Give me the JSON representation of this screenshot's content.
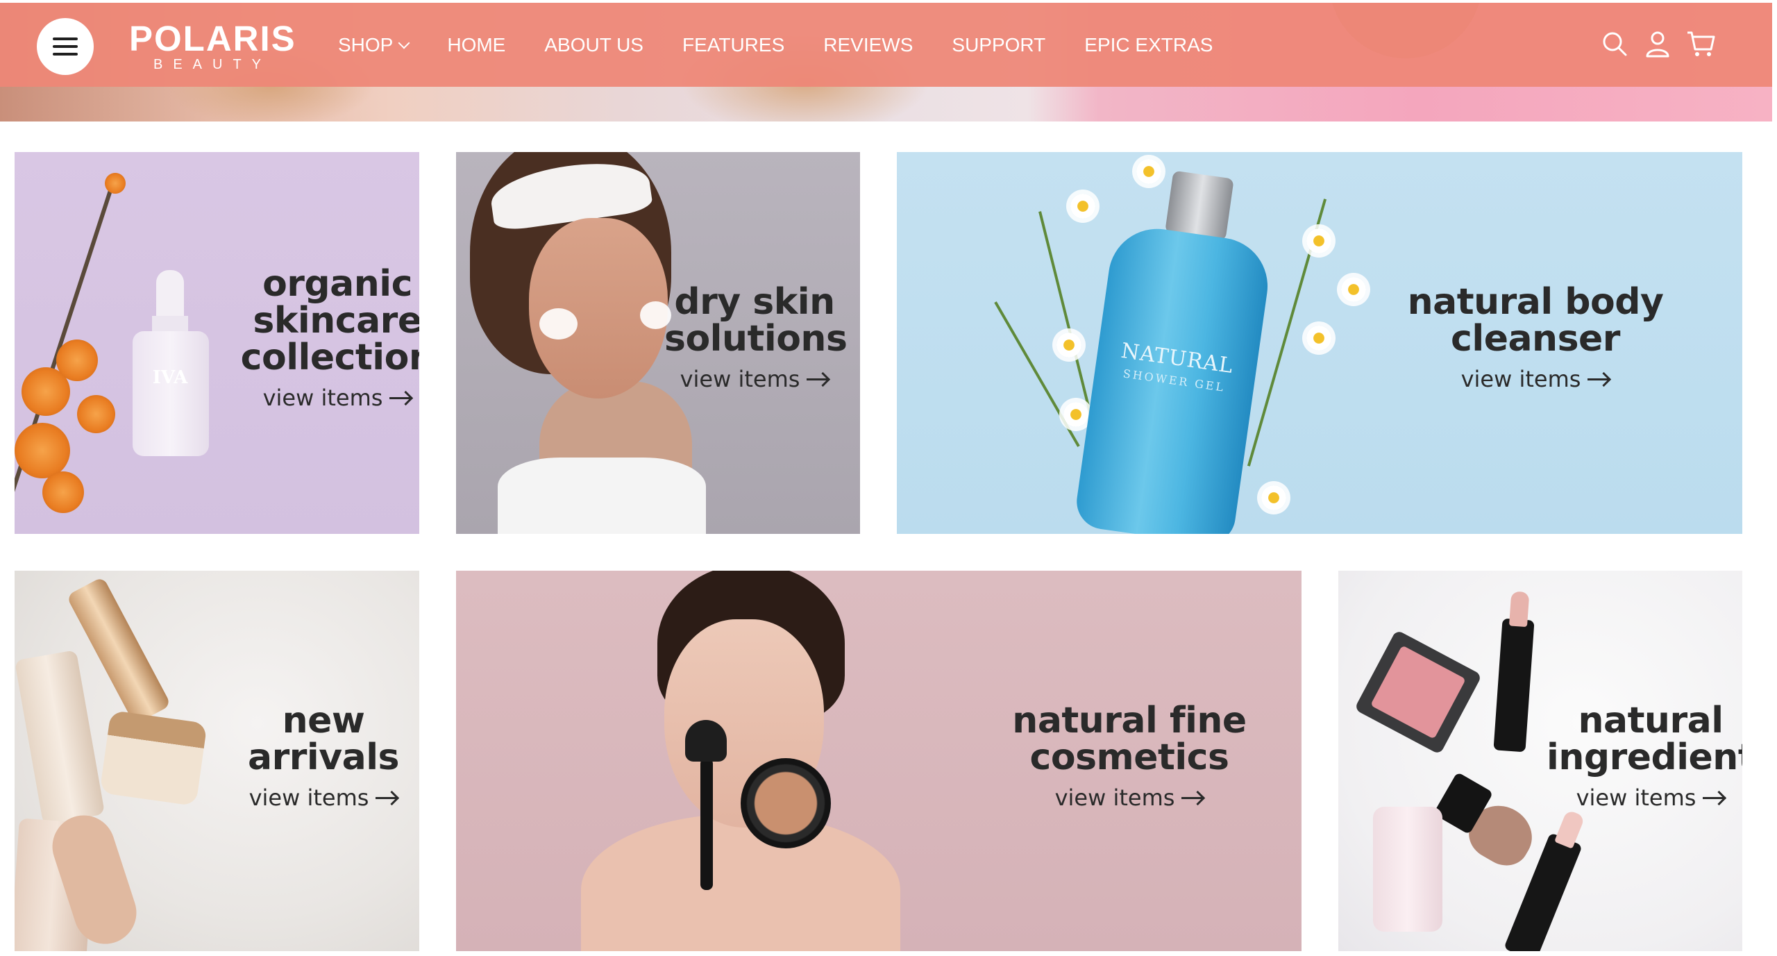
{
  "header": {
    "brand": "POLARIS",
    "brand_sub": "BEAUTY",
    "nav": [
      {
        "label": "SHOP",
        "has_dropdown": true
      },
      {
        "label": "HOME"
      },
      {
        "label": "ABOUT US"
      },
      {
        "label": "FEATURES"
      },
      {
        "label": "REVIEWS"
      },
      {
        "label": "SUPPORT"
      },
      {
        "label": "EPIC EXTRAS"
      }
    ],
    "icons": [
      "menu-icon",
      "search-icon",
      "account-icon",
      "cart-icon"
    ]
  },
  "tiles": [
    {
      "title_lines": [
        "organic",
        "skincare",
        "collection"
      ],
      "cta": "view items",
      "product_label": "IVA",
      "bg": "#d7c5e3"
    },
    {
      "title_lines": [
        "dry skin",
        "solutions"
      ],
      "cta": "view items",
      "bg": "#b3aeb7"
    },
    {
      "title_lines": [
        "natural body",
        "cleanser"
      ],
      "cta": "view items",
      "product_label": "NATURAL",
      "product_sub": "SHOWER GEL",
      "bg": "#c2e0f0"
    },
    {
      "title_lines": [
        "new",
        "arrivals"
      ],
      "cta": "view items",
      "bg": "#ece9e6"
    },
    {
      "title_lines": [
        "natural fine",
        "cosmetics"
      ],
      "cta": "view items",
      "bg": "#d9b7bb"
    },
    {
      "title_lines": [
        "natural",
        "ingredient"
      ],
      "cta": "view items",
      "bg": "#f2f1f3"
    }
  ],
  "colors": {
    "nav_bg": "#ee8776",
    "nav_text": "#ffffff",
    "tile_text": "#2a2a2a"
  }
}
